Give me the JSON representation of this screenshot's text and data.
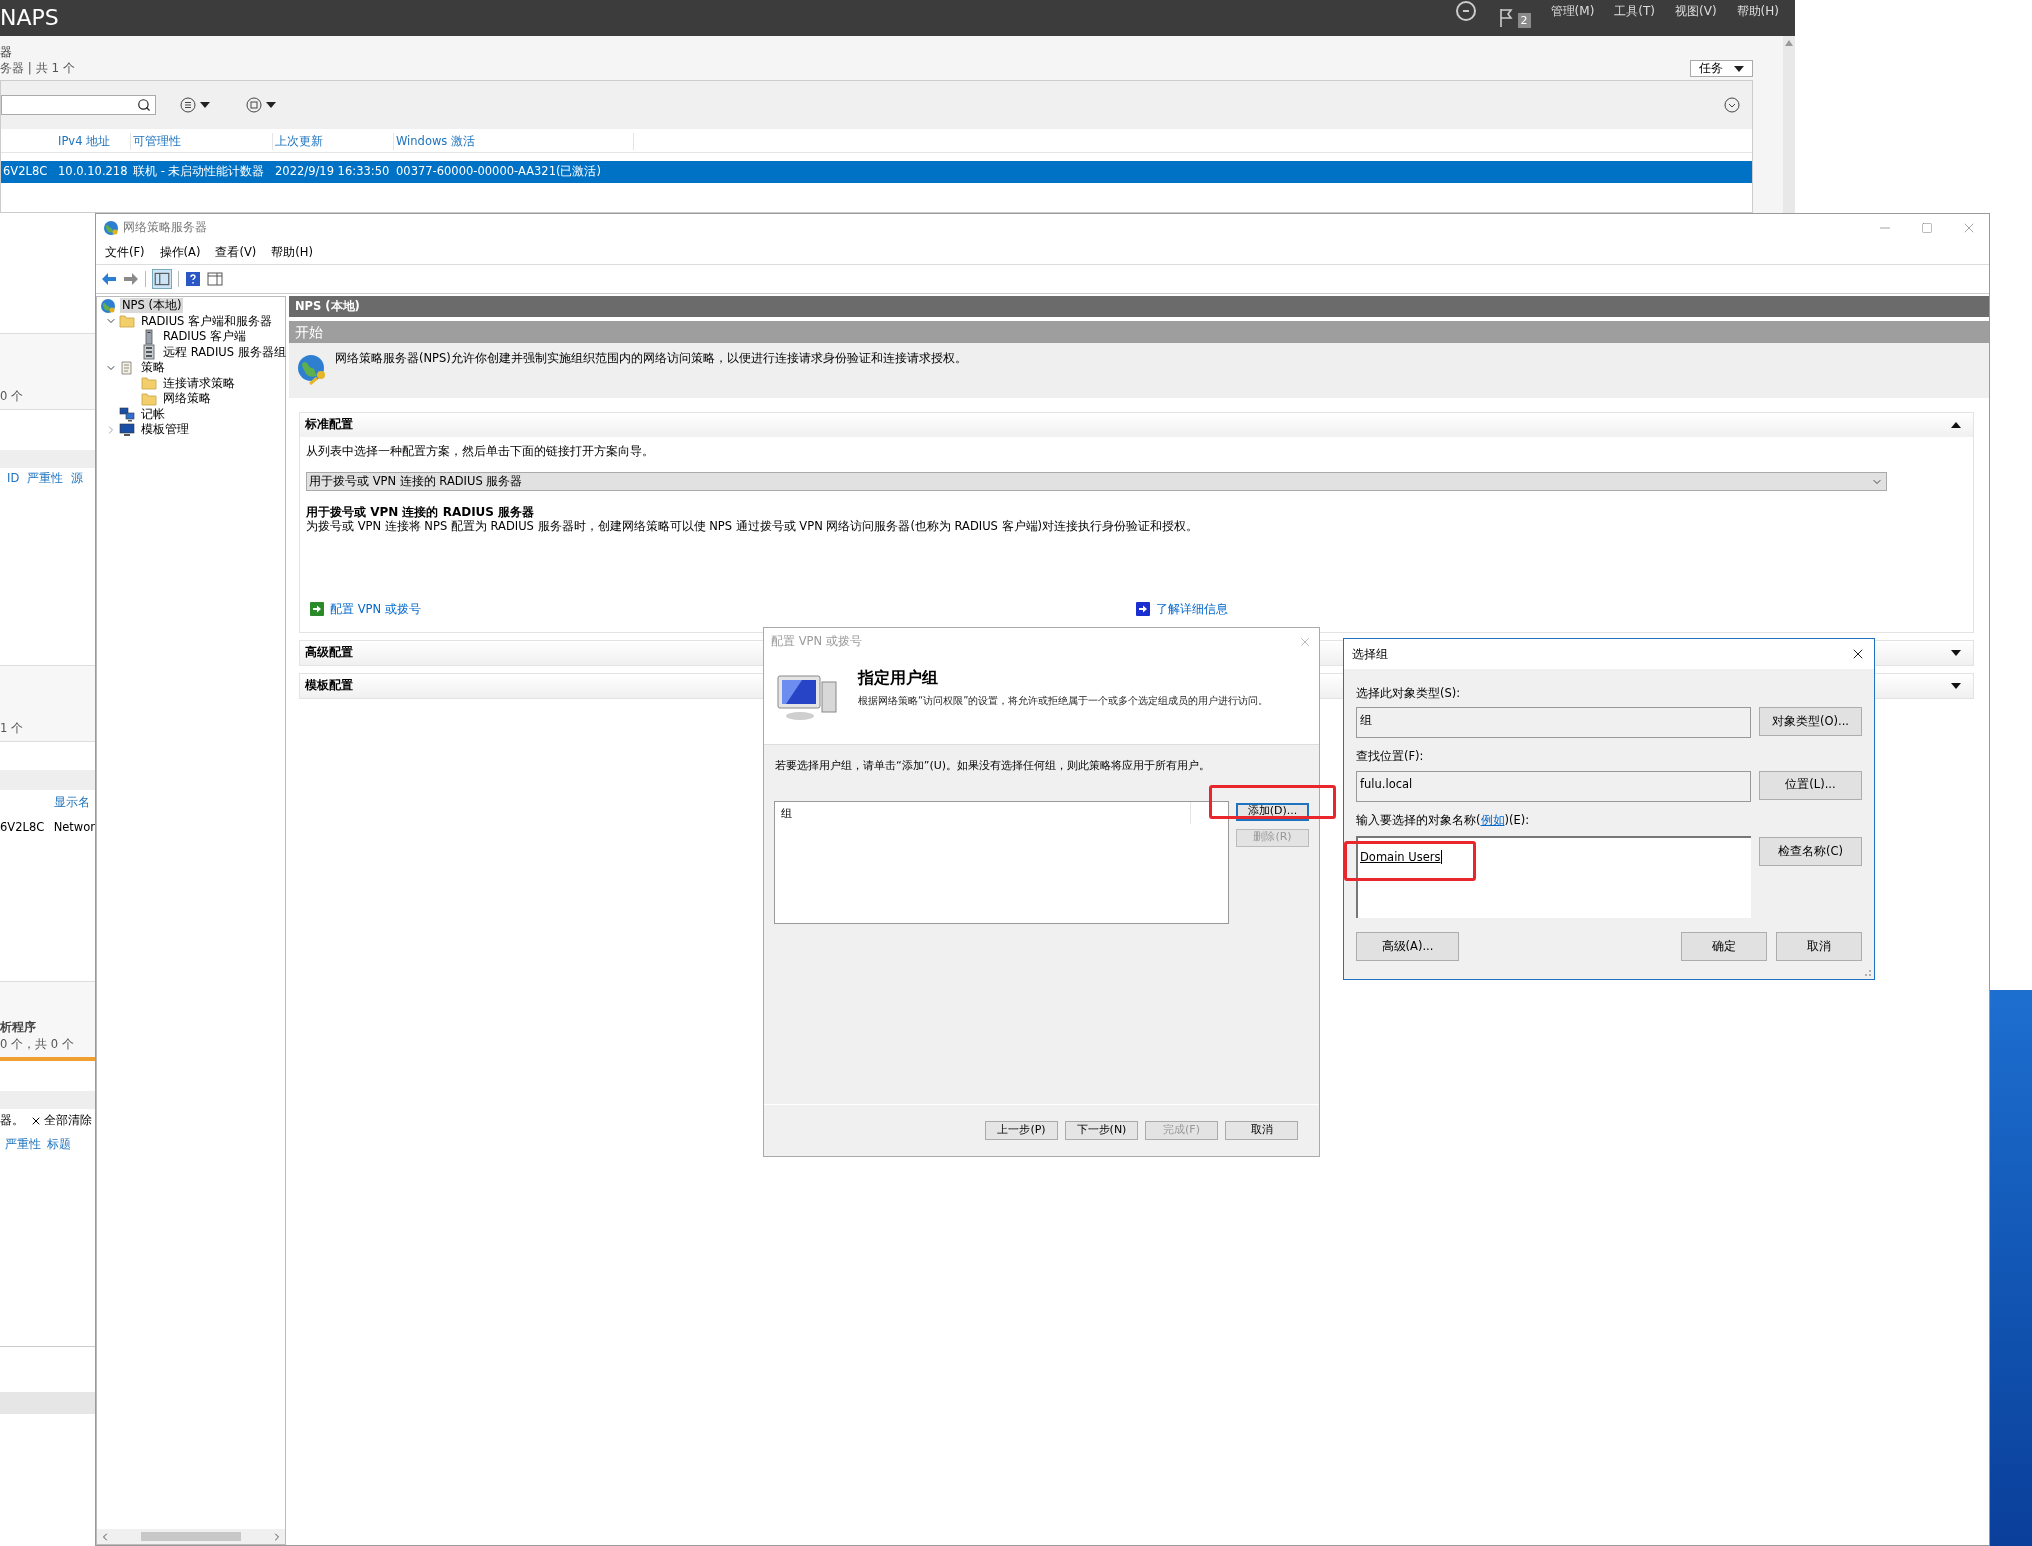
{
  "server_manager": {
    "title": "NAPS",
    "menu": [
      "管理(M)",
      "工具(T)",
      "视图(V)",
      "帮助(H)"
    ],
    "flag_count": "2",
    "heading": "器",
    "summary": "务器 | 共 1 个",
    "tasks_button": "任务",
    "columns": [
      "",
      "IPv4 地址",
      "可管理性",
      "上次更新",
      "Windows 激活"
    ],
    "rows": [
      {
        "selected": true,
        "cells": [
          "6V2L8C",
          "10.0.10.218",
          "联机 - 未启动性能计数器",
          "2022/9/19 16:33:50",
          "00377-60000-00000-AA321(已激活)"
        ]
      }
    ],
    "left_strip": {
      "tile_1_count": "0 个",
      "tile_1_columns": [
        "ID",
        "严重性",
        "源"
      ],
      "tile_2_count": "1 个",
      "tile_2_column": "显示名",
      "tile_2_row": [
        "6V2L8C",
        "Networ"
      ],
      "tile_3_title": "析程序",
      "tile_3_count": "0 个，共 0 个",
      "tile_4_notice": "器。",
      "tile_4_clear": "全部清除",
      "tile_4_columns": [
        "严重性",
        "标题"
      ]
    }
  },
  "nps": {
    "title": "网络策略服务器",
    "menu": [
      "文件(F)",
      "操作(A)",
      "查看(V)",
      "帮助(H)"
    ],
    "tree": [
      {
        "label": "NPS (本地)",
        "kind": "root",
        "selected": true,
        "children": [
          {
            "label": "RADIUS 客户端和服务器",
            "kind": "folder",
            "selected": false,
            "expanded": true,
            "children": [
              {
                "label": "RADIUS 客户端",
                "kind": "device",
                "selected": false
              },
              {
                "label": "远程 RADIUS 服务器组",
                "kind": "device-group",
                "selected": false
              }
            ]
          },
          {
            "label": "策略",
            "kind": "document",
            "selected": false,
            "expanded": true,
            "children": [
              {
                "label": "连接请求策略",
                "kind": "folder",
                "selected": false
              },
              {
                "label": "网络策略",
                "kind": "folder",
                "selected": false
              }
            ]
          },
          {
            "label": "记帐",
            "kind": "computers",
            "selected": false
          },
          {
            "label": "模板管理",
            "kind": "monitor",
            "selected": false,
            "expanded": false
          }
        ]
      }
    ],
    "header": "NPS (本地)",
    "start_title": "开始",
    "intro": "网络策略服务器(NPS)允许你创建并强制实施组织范围内的网络访问策略，以便进行连接请求身份验证和连接请求授权。",
    "sections": [
      {
        "title": "标准配置",
        "expanded": true,
        "hint": "从列表中选择一种配置方案，然后单击下面的链接打开方案向导。",
        "scenario": "用于拨号或 VPN 连接的 RADIUS 服务器",
        "scenario_title": "用于拨号或 VPN 连接的 RADIUS 服务器",
        "scenario_text": "为拨号或 VPN 连接将 NPS 配置为 RADIUS 服务器时，创建网络策略可以使 NPS 通过拨号或 VPN 网络访问服务器(也称为 RADIUS 客户端)对连接执行身份验证和授权。",
        "links": [
          {
            "label": "配置 VPN 或拨号",
            "kind": "wizard"
          },
          {
            "label": "了解详细信息",
            "kind": "info"
          }
        ]
      },
      {
        "title": "高级配置",
        "expanded": false
      },
      {
        "title": "模板配置",
        "expanded": false
      }
    ]
  },
  "vpn_dialog": {
    "title": "配置 VPN 或拨号",
    "active": false,
    "heading": "指定用户组",
    "description": "根据网络策略“访问权限”的设置，将允许或拒绝属于一个或多个选定组成员的用户进行访问。",
    "instruction": "若要选择用户组，请单击“添加”(U)。如果没有选择任何组，则此策略将应用于所有用户。",
    "list_column": "组",
    "side_buttons": [
      {
        "label": "添加(D)...",
        "disabled": false,
        "focused": true
      },
      {
        "label": "删除(R)",
        "disabled": true,
        "focused": false
      }
    ],
    "footer_buttons": [
      {
        "label": "上一步(P)",
        "disabled": false
      },
      {
        "label": "下一步(N)",
        "disabled": false
      },
      {
        "label": "完成(F)",
        "disabled": true
      },
      {
        "label": "取消",
        "disabled": false
      }
    ]
  },
  "select_dialog": {
    "title": "选择组",
    "active": true,
    "object_type_label": "选择此对象类型(S):",
    "object_type": "组",
    "object_type_button": "对象类型(O)...",
    "location_label": "查找位置(F):",
    "location": "fulu.local",
    "location_button": "位置(L)...",
    "names_label_before": "输入要选择的对象名称(",
    "names_label_link": "例如",
    "names_label_after": ")(E):",
    "names": "Domain Users",
    "check_button": "检查名称(C)",
    "advanced_button": "高级(A)...",
    "ok_button": "确定",
    "cancel_button": "取消"
  }
}
